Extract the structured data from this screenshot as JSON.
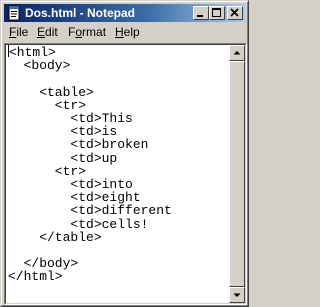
{
  "window": {
    "title": "Dos.html - Notepad",
    "icon": "notepad-icon"
  },
  "titlebar_buttons": {
    "minimize": "minimize-icon",
    "maximize": "maximize-icon",
    "close": "close-icon"
  },
  "menu": [
    {
      "accel": "F",
      "rest": "ile"
    },
    {
      "accel": "E",
      "rest": "dit"
    },
    {
      "pre": "F",
      "accel": "o",
      "rest": "rmat"
    },
    {
      "accel": "H",
      "rest": "elp"
    }
  ],
  "editor": {
    "lines": [
      "<html>",
      "  <body>",
      "",
      "    <table>",
      "      <tr>",
      "        <td>This",
      "        <td>is",
      "        <td>broken",
      "        <td>up",
      "      <tr>",
      "        <td>into",
      "        <td>eight",
      "        <td>different",
      "        <td>cells!",
      "    </table>",
      "",
      "  </body>",
      "</html>"
    ]
  },
  "colors": {
    "titlebar_start": "#0a246a",
    "titlebar_end": "#a6caf0",
    "face": "#d4d0c8"
  }
}
